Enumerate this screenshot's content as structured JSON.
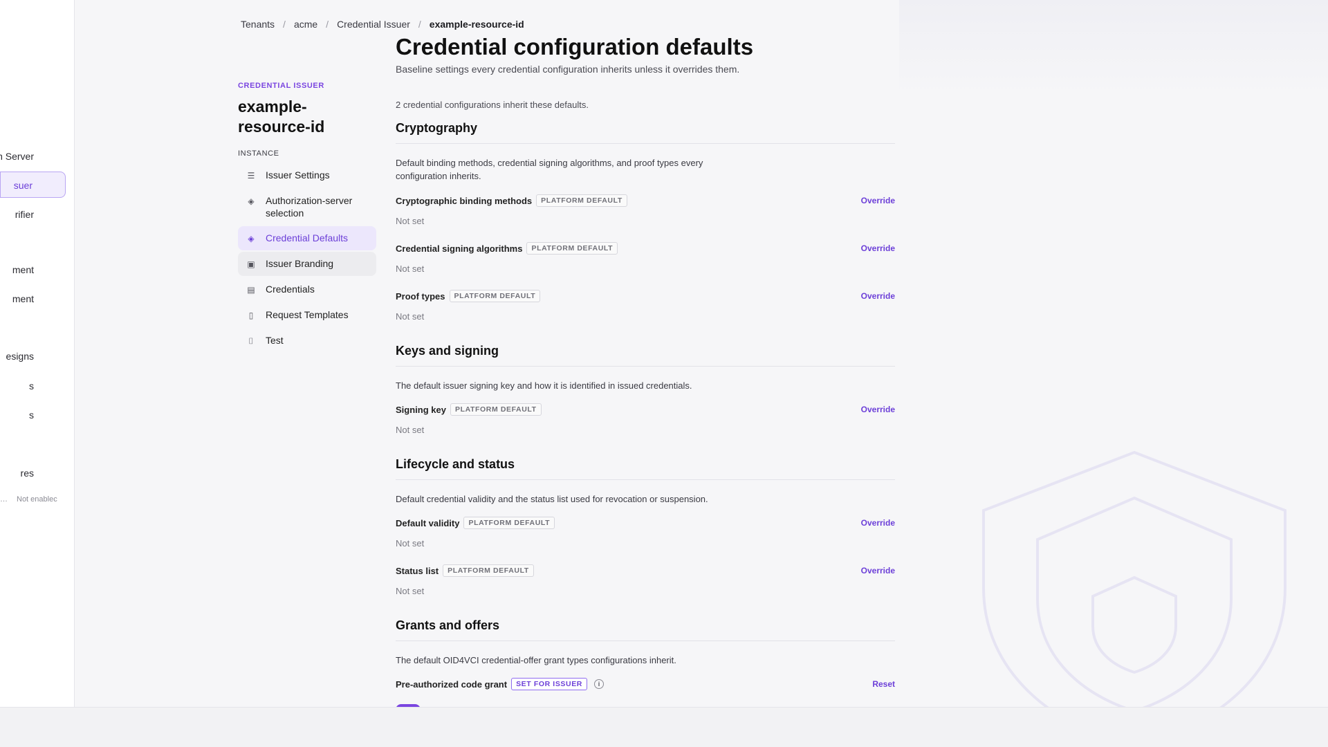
{
  "global_nav": {
    "items": [
      {
        "label": "n Server",
        "active": false
      },
      {
        "label": "suer",
        "active": true
      },
      {
        "label": "rifier",
        "active": false
      },
      {
        "label": "ment",
        "active": false
      },
      {
        "label": "ment",
        "active": false
      },
      {
        "label": "esigns",
        "active": false
      },
      {
        "label": "s",
        "active": false
      },
      {
        "label": "s",
        "active": false
      },
      {
        "label": "res",
        "active": false
      }
    ],
    "status_dots": "…",
    "status_text": "Not enablec"
  },
  "breadcrumb": {
    "items": [
      "Tenants",
      "acme",
      "Credential Issuer"
    ],
    "current": "example-resource-id",
    "separator": "/"
  },
  "sidebar": {
    "eyebrow": "CREDENTIAL ISSUER",
    "title_line1": "example-",
    "title_line2": "resource-id",
    "section_label": "INSTANCE",
    "items": [
      {
        "label": "Issuer Settings",
        "icon": "sliders-icon"
      },
      {
        "label": "Authorization-server selection",
        "icon": "layers-icon"
      },
      {
        "label": "Credential Defaults",
        "icon": "layers-icon",
        "active": true
      },
      {
        "label": "Issuer Branding",
        "icon": "palette-doc-icon",
        "hover": true
      },
      {
        "label": "Credentials",
        "icon": "id-card-icon"
      },
      {
        "label": "Request Templates",
        "icon": "document-icon"
      },
      {
        "label": "Test",
        "icon": "flask-icon"
      }
    ]
  },
  "main": {
    "title": "Credential configuration defaults",
    "subtitle": "Baseline settings every credential configuration inherits unless it overrides them.",
    "inherit_note": "2 credential configurations inherit these defaults.",
    "sections": [
      {
        "title": "Cryptography",
        "desc": "Default binding methods, credential signing algorithms, and proof types every configuration inherits.",
        "fields": [
          {
            "label": "Cryptographic binding methods",
            "badge": "PLATFORM DEFAULT",
            "action": "Override",
            "value": "Not set"
          },
          {
            "label": "Credential signing algorithms",
            "badge": "PLATFORM DEFAULT",
            "action": "Override",
            "value": "Not set"
          },
          {
            "label": "Proof types",
            "badge": "PLATFORM DEFAULT",
            "action": "Override",
            "value": "Not set"
          }
        ]
      },
      {
        "title": "Keys and signing",
        "desc": "The default issuer signing key and how it is identified in issued credentials.",
        "fields": [
          {
            "label": "Signing key",
            "badge": "PLATFORM DEFAULT",
            "action": "Override",
            "value": "Not set"
          }
        ]
      },
      {
        "title": "Lifecycle and status",
        "desc": "Default credential validity and the status list used for revocation or suspension.",
        "fields": [
          {
            "label": "Default validity",
            "badge": "PLATFORM DEFAULT",
            "action": "Override",
            "value": "Not set"
          },
          {
            "label": "Status list",
            "badge": "PLATFORM DEFAULT",
            "action": "Override",
            "value": "Not set"
          }
        ]
      },
      {
        "title": "Grants and offers",
        "desc": "The default OID4VCI credential-offer grant types configurations inherit.",
        "fields": [
          {
            "label": "Pre-authorized code grant",
            "badge": "SET FOR ISSUER",
            "action": "Reset",
            "info": "i"
          }
        ]
      }
    ]
  },
  "colors": {
    "accent": "#7a45e0",
    "active_bg": "#ece7fc",
    "page_bg": "#f6f6f8"
  }
}
